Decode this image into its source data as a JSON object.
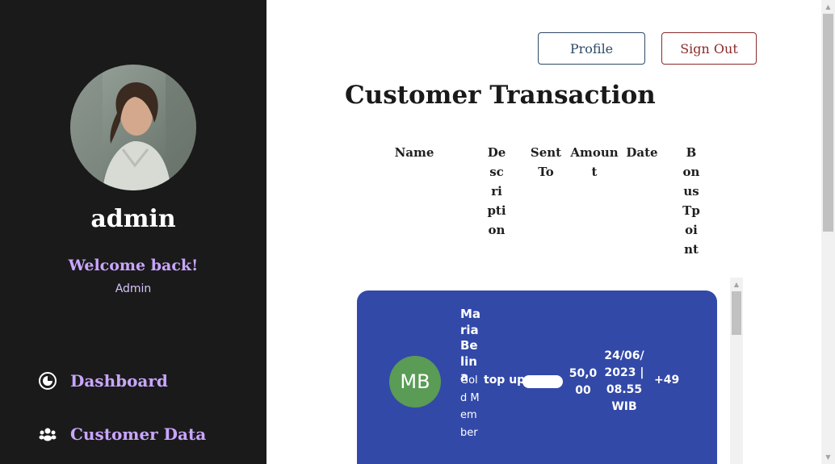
{
  "sidebar": {
    "username": "admin",
    "welcome": "Welcome back!",
    "role": "Admin",
    "nav": [
      {
        "label": "Dashboard",
        "icon": "dashboard-icon"
      },
      {
        "label": "Customer Data",
        "icon": "users-icon"
      }
    ]
  },
  "header": {
    "profile_label": "Profile",
    "signout_label": "Sign Out"
  },
  "main": {
    "title": "Customer Transaction",
    "columns": [
      "Name",
      "Description",
      "Sent To",
      "Amount",
      "Date",
      "BonusTpoint"
    ]
  },
  "transactions": [
    {
      "initials": "MB",
      "name": "Maria Belina",
      "member": "Gold Member",
      "description": "top up",
      "sent_to": "",
      "amount": "50,000",
      "date": "24/06/ 2023 | 08.55 WIB",
      "bonus": "+49"
    }
  ],
  "colors": {
    "sidebar_bg": "#1a1a1a",
    "accent": "#c9a6ff",
    "card_bg": "#3249a8",
    "avatar_bg": "#5a9b56"
  }
}
